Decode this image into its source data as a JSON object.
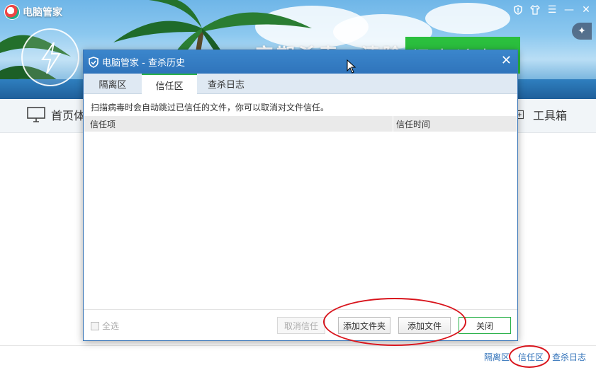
{
  "app": {
    "name": "电脑管家",
    "slogan": "定期杀毒，清除风险",
    "scan_button": "闪电杀毒"
  },
  "window_controls": {
    "icons": [
      "shield-icon",
      "shirt-icon",
      "menu-icon",
      "minimize-icon",
      "close-icon"
    ]
  },
  "nav": {
    "home_label": "首页体检",
    "toolbox_label": "工具箱"
  },
  "footer_links": {
    "quarantine": "隔离区",
    "trust": "信任区",
    "log": "查杀日志"
  },
  "dialog": {
    "title": "电脑管家 - 查杀历史",
    "tabs": [
      {
        "label": "隔离区",
        "active": false
      },
      {
        "label": "信任区",
        "active": true
      },
      {
        "label": "查杀日志",
        "active": false
      }
    ],
    "hint": "扫描病毒时会自动跳过已信任的文件，你可以取消对文件信任。",
    "columns": [
      "信任项",
      "信任时间"
    ],
    "rows": [],
    "select_all": "全选",
    "buttons": {
      "cancel_trust": "取消信任",
      "add_folder": "添加文件夹",
      "add_file": "添加文件",
      "close": "关闭"
    }
  },
  "colors": {
    "title_bar": "#2f74bb",
    "accent_green": "#2bb14a",
    "annotation_red": "#d8141c",
    "link_blue": "#2d6fb8"
  }
}
